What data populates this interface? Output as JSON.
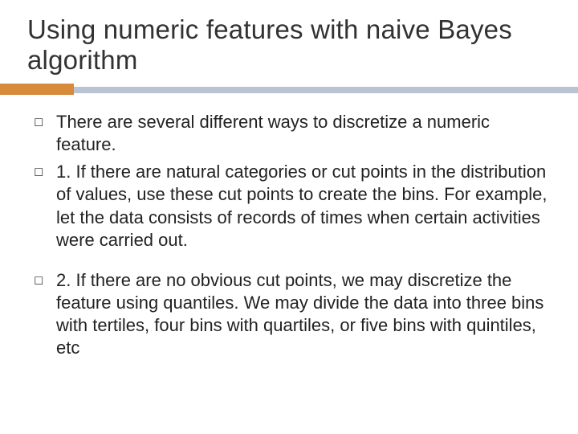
{
  "title": "Using numeric features with naive Bayes algorithm",
  "bullets": [
    {
      "marker": "◻",
      "text": "There are several different ways to discretize a numeric feature."
    },
    {
      "marker": "◻",
      "text": "1. If there are natural categories or cut points in the distribution of values, use these cut points to create the bins. For example, let the data consists of records of times when certain activities were carried out."
    },
    {
      "marker": "◻",
      "text": "2. If there are no obvious cut points, we may discretize the feature using quantiles. We may divide the data into three bins with tertiles, four bins with quartiles, or five bins with quintiles, etc"
    }
  ]
}
